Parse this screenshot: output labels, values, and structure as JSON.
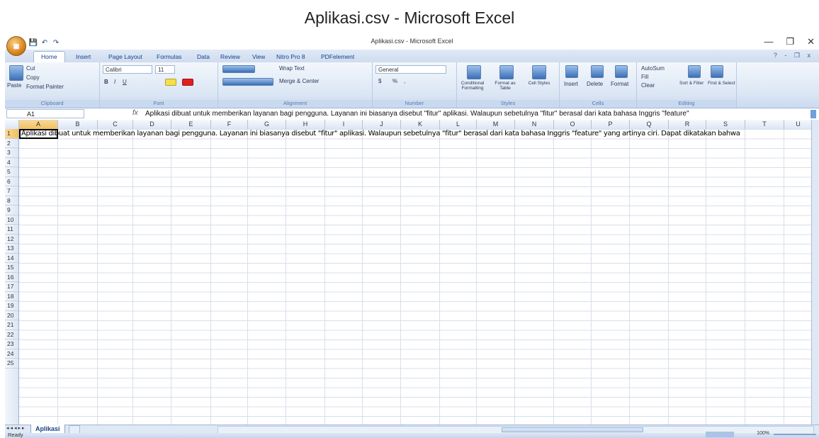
{
  "page_caption": "Aplikasi.csv - Microsoft Excel",
  "window": {
    "title": "Aplikasi.csv - Microsoft Excel",
    "office_button": "Office",
    "controls": {
      "minimize": "—",
      "restore": "❐",
      "close": "✕"
    }
  },
  "quick_access": {
    "save": "💾",
    "undo": "↶",
    "redo": "↷"
  },
  "tabs": [
    "Home",
    "Insert",
    "Page Layout",
    "Formulas",
    "Data",
    "Review",
    "View",
    "Nitro Pro 8",
    "PDFelement"
  ],
  "tab_controls": "? - ❐ x",
  "ribbon": {
    "clipboard": {
      "label": "Clipboard",
      "paste": "Paste",
      "cut": "Cut",
      "copy": "Copy",
      "format_painter": "Format Painter"
    },
    "font": {
      "label": "Font",
      "name": "Calibri",
      "size": "11",
      "bold": "B",
      "italic": "I",
      "underline": "U"
    },
    "alignment": {
      "label": "Alignment",
      "wrap": "Wrap Text",
      "merge": "Merge & Center"
    },
    "number": {
      "label": "Number",
      "format": "General",
      "currency": "$",
      "percent": "%",
      "comma": ","
    },
    "styles": {
      "label": "Styles",
      "conditional": "Conditional Formatting",
      "format_table": "Format as Table",
      "cell_styles": "Cell Styles"
    },
    "cells": {
      "label": "Cells",
      "insert": "Insert",
      "delete": "Delete",
      "format": "Format"
    },
    "editing": {
      "label": "Editing",
      "autosum": "AutoSum",
      "fill": "Fill",
      "clear": "Clear",
      "sort": "Sort & Filter",
      "find": "Find & Select"
    }
  },
  "formula_bar": {
    "name_box": "A1",
    "fx": "fx",
    "content": "Aplikasi dibuat untuk memberikan layanan bagi pengguna. Layanan ini biasanya disebut \"fitur\" aplikasi. Walaupun sebetulnya \"fitur\" berasal dari kata bahasa Inggris \"feature\""
  },
  "columns": [
    "A",
    "B",
    "C",
    "D",
    "E",
    "F",
    "G",
    "H",
    "I",
    "J",
    "K",
    "L",
    "M",
    "N",
    "O",
    "P",
    "Q",
    "R",
    "S",
    "T",
    "U"
  ],
  "rows": [
    "1",
    "2",
    "3",
    "4",
    "5",
    "6",
    "7",
    "8",
    "9",
    "10",
    "11",
    "12",
    "13",
    "14",
    "15",
    "16",
    "17",
    "18",
    "19",
    "20",
    "21",
    "22",
    "23",
    "24",
    "25"
  ],
  "cell_A1": "Aplikasi dibuat untuk memberikan layanan bagi pengguna. Layanan ini biasanya disebut \"fitur\" aplikasi. Walaupun sebetulnya \"fitur\" berasal dari kata bahasa Inggris \"feature\" yang artinya ciri. Dapat dikatakan bahwa",
  "sheet_tab": "Aplikasi",
  "status": "Ready",
  "zoom": "100%"
}
